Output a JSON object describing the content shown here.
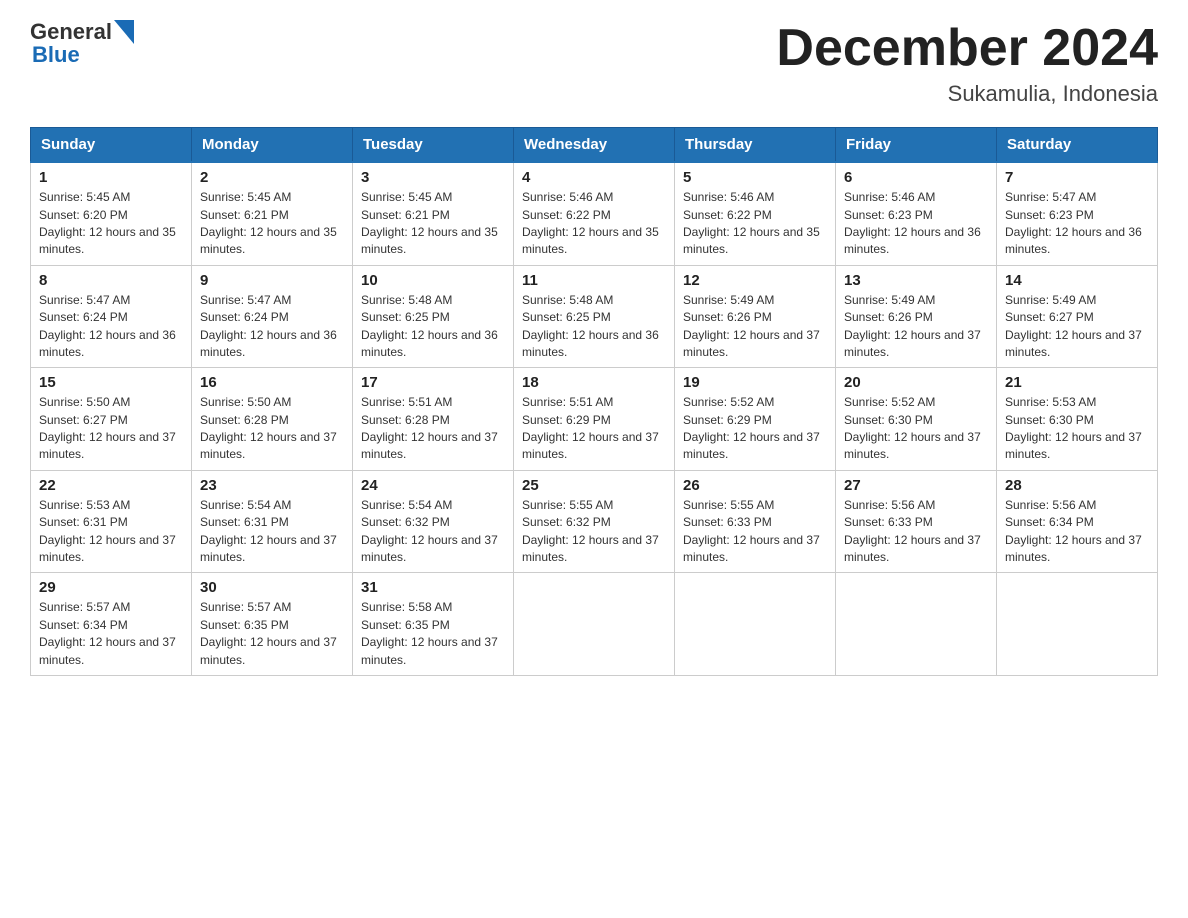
{
  "logo": {
    "text_general": "General",
    "text_blue": "Blue"
  },
  "title": "December 2024",
  "location": "Sukamulia, Indonesia",
  "days_of_week": [
    "Sunday",
    "Monday",
    "Tuesday",
    "Wednesday",
    "Thursday",
    "Friday",
    "Saturday"
  ],
  "weeks": [
    [
      {
        "day": "1",
        "sunrise": "5:45 AM",
        "sunset": "6:20 PM",
        "daylight": "12 hours and 35 minutes."
      },
      {
        "day": "2",
        "sunrise": "5:45 AM",
        "sunset": "6:21 PM",
        "daylight": "12 hours and 35 minutes."
      },
      {
        "day": "3",
        "sunrise": "5:45 AM",
        "sunset": "6:21 PM",
        "daylight": "12 hours and 35 minutes."
      },
      {
        "day": "4",
        "sunrise": "5:46 AM",
        "sunset": "6:22 PM",
        "daylight": "12 hours and 35 minutes."
      },
      {
        "day": "5",
        "sunrise": "5:46 AM",
        "sunset": "6:22 PM",
        "daylight": "12 hours and 35 minutes."
      },
      {
        "day": "6",
        "sunrise": "5:46 AM",
        "sunset": "6:23 PM",
        "daylight": "12 hours and 36 minutes."
      },
      {
        "day": "7",
        "sunrise": "5:47 AM",
        "sunset": "6:23 PM",
        "daylight": "12 hours and 36 minutes."
      }
    ],
    [
      {
        "day": "8",
        "sunrise": "5:47 AM",
        "sunset": "6:24 PM",
        "daylight": "12 hours and 36 minutes."
      },
      {
        "day": "9",
        "sunrise": "5:47 AM",
        "sunset": "6:24 PM",
        "daylight": "12 hours and 36 minutes."
      },
      {
        "day": "10",
        "sunrise": "5:48 AM",
        "sunset": "6:25 PM",
        "daylight": "12 hours and 36 minutes."
      },
      {
        "day": "11",
        "sunrise": "5:48 AM",
        "sunset": "6:25 PM",
        "daylight": "12 hours and 36 minutes."
      },
      {
        "day": "12",
        "sunrise": "5:49 AM",
        "sunset": "6:26 PM",
        "daylight": "12 hours and 37 minutes."
      },
      {
        "day": "13",
        "sunrise": "5:49 AM",
        "sunset": "6:26 PM",
        "daylight": "12 hours and 37 minutes."
      },
      {
        "day": "14",
        "sunrise": "5:49 AM",
        "sunset": "6:27 PM",
        "daylight": "12 hours and 37 minutes."
      }
    ],
    [
      {
        "day": "15",
        "sunrise": "5:50 AM",
        "sunset": "6:27 PM",
        "daylight": "12 hours and 37 minutes."
      },
      {
        "day": "16",
        "sunrise": "5:50 AM",
        "sunset": "6:28 PM",
        "daylight": "12 hours and 37 minutes."
      },
      {
        "day": "17",
        "sunrise": "5:51 AM",
        "sunset": "6:28 PM",
        "daylight": "12 hours and 37 minutes."
      },
      {
        "day": "18",
        "sunrise": "5:51 AM",
        "sunset": "6:29 PM",
        "daylight": "12 hours and 37 minutes."
      },
      {
        "day": "19",
        "sunrise": "5:52 AM",
        "sunset": "6:29 PM",
        "daylight": "12 hours and 37 minutes."
      },
      {
        "day": "20",
        "sunrise": "5:52 AM",
        "sunset": "6:30 PM",
        "daylight": "12 hours and 37 minutes."
      },
      {
        "day": "21",
        "sunrise": "5:53 AM",
        "sunset": "6:30 PM",
        "daylight": "12 hours and 37 minutes."
      }
    ],
    [
      {
        "day": "22",
        "sunrise": "5:53 AM",
        "sunset": "6:31 PM",
        "daylight": "12 hours and 37 minutes."
      },
      {
        "day": "23",
        "sunrise": "5:54 AM",
        "sunset": "6:31 PM",
        "daylight": "12 hours and 37 minutes."
      },
      {
        "day": "24",
        "sunrise": "5:54 AM",
        "sunset": "6:32 PM",
        "daylight": "12 hours and 37 minutes."
      },
      {
        "day": "25",
        "sunrise": "5:55 AM",
        "sunset": "6:32 PM",
        "daylight": "12 hours and 37 minutes."
      },
      {
        "day": "26",
        "sunrise": "5:55 AM",
        "sunset": "6:33 PM",
        "daylight": "12 hours and 37 minutes."
      },
      {
        "day": "27",
        "sunrise": "5:56 AM",
        "sunset": "6:33 PM",
        "daylight": "12 hours and 37 minutes."
      },
      {
        "day": "28",
        "sunrise": "5:56 AM",
        "sunset": "6:34 PM",
        "daylight": "12 hours and 37 minutes."
      }
    ],
    [
      {
        "day": "29",
        "sunrise": "5:57 AM",
        "sunset": "6:34 PM",
        "daylight": "12 hours and 37 minutes."
      },
      {
        "day": "30",
        "sunrise": "5:57 AM",
        "sunset": "6:35 PM",
        "daylight": "12 hours and 37 minutes."
      },
      {
        "day": "31",
        "sunrise": "5:58 AM",
        "sunset": "6:35 PM",
        "daylight": "12 hours and 37 minutes."
      },
      null,
      null,
      null,
      null
    ]
  ]
}
